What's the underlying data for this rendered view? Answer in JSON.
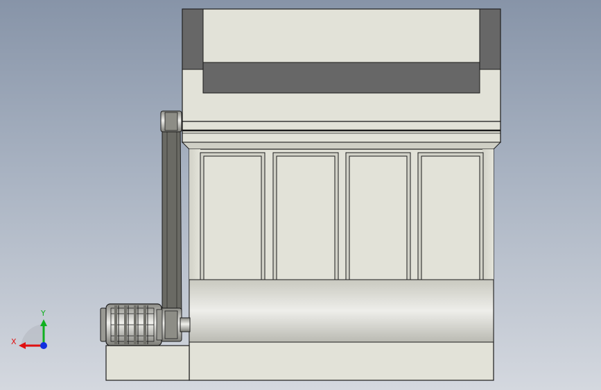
{
  "triad": {
    "x_label": "X",
    "y_label": "Y"
  },
  "colors": {
    "body_fill": "#e2e2d8",
    "dark_panel": "#676767",
    "outline": "#1a1a1a",
    "belt": "#6a6a64",
    "x_axis": "#e01010",
    "y_axis": "#10b020",
    "z_axis": "#1030e0"
  }
}
